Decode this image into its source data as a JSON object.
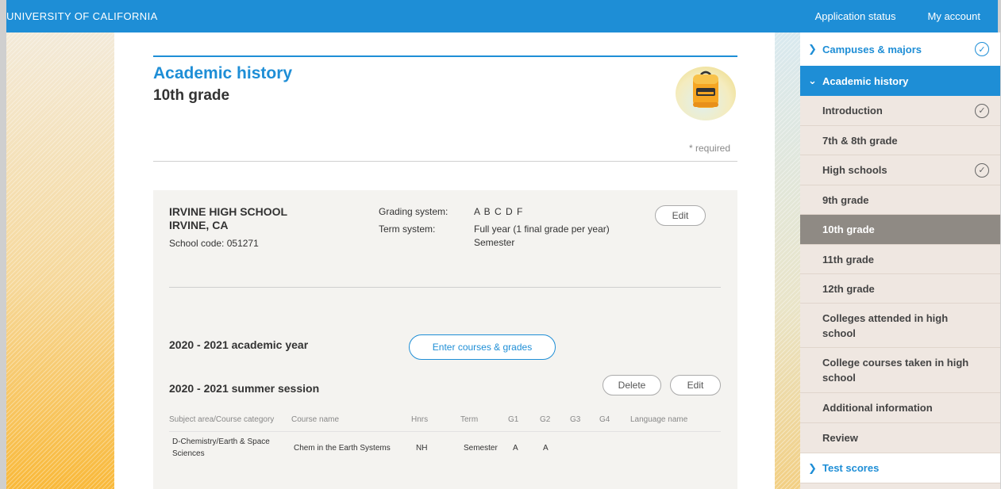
{
  "header": {
    "brand": "UNIVERSITY OF CALIFORNIA",
    "links": [
      "Application status",
      "My account"
    ]
  },
  "main": {
    "section_title": "Academic history",
    "page_title": "10th grade",
    "required_note": "* required",
    "icon": "backpack-icon"
  },
  "school": {
    "name": "IRVINE HIGH SCHOOL",
    "city": "IRVINE, CA",
    "code": "School code: 051271",
    "grading_label": "Grading system:",
    "grading_value": "A B C D F",
    "term_label": "Term system:",
    "term_value": "Full year (1 final grade per year)",
    "term_value2": "Semester",
    "edit_label": "Edit"
  },
  "year": {
    "label": "2020 - 2021 academic year",
    "enter_label": "Enter courses & grades"
  },
  "summer": {
    "label": "2020 - 2021 summer session",
    "delete_label": "Delete",
    "edit_label": "Edit"
  },
  "table": {
    "headers": [
      "Subject area/Course category",
      "Course name",
      "Hnrs",
      "Term",
      "G1",
      "G2",
      "G3",
      "G4",
      "Language name"
    ],
    "rows": [
      {
        "subject_line1": "D-Chemistry/Earth & Space",
        "subject_line2": "Sciences",
        "course": "Chem in the Earth Systems",
        "hnrs": "NH",
        "term": "Semester",
        "g1": "A",
        "g2": "A",
        "g3": "",
        "g4": "",
        "language": ""
      }
    ]
  },
  "sidebar": {
    "campuses": "Campuses & majors",
    "academic": "Academic history",
    "items": [
      "Introduction",
      "7th & 8th grade",
      "High schools",
      "9th grade",
      "10th grade",
      "11th grade",
      "12th grade",
      "Colleges attended in high school",
      "College courses taken in high school",
      "Additional information",
      "Review"
    ],
    "test_scores": "Test scores",
    "completed_items": [
      "Campuses & majors",
      "Introduction",
      "High schools"
    ],
    "selected_item": "10th grade"
  },
  "colors": {
    "primary_blue": "#1e8ed6",
    "sidebar_bg": "#efe7e1",
    "selected_bg": "#8f8a84"
  }
}
